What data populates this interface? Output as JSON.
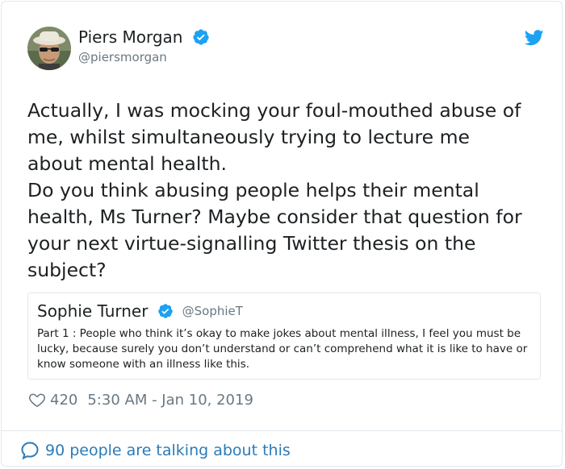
{
  "author": {
    "display_name": "Piers Morgan",
    "handle": "@piersmorgan",
    "verified": true,
    "avatar_icon": "avatar-photo"
  },
  "tweet": {
    "text": "Actually, I was mocking your foul-mouthed abuse of\nme, whilst simultaneously trying to lecture me\nabout mental health.\nDo you think abusing people helps their mental\nhealth, Ms Turner? Maybe consider that question for\nyour next virtue-signalling Twitter thesis on the\nsubject?"
  },
  "quoted_tweet": {
    "display_name": "Sophie Turner",
    "handle": "@SophieT",
    "verified": true,
    "text": "Part 1 : People who think it’s okay to make jokes about mental illness, I feel you must be lucky, because surely you don’t understand or can’t comprehend what it is like to have or know someone with an illness like this."
  },
  "meta": {
    "likes": "420",
    "timestamp": "5:30 AM - Jan 10, 2019"
  },
  "footer": {
    "talking_text": "90 people are talking about this"
  },
  "colors": {
    "link_blue": "#2b7bb9",
    "twitter_blue": "#1da1f2",
    "muted_gray": "#697882",
    "border": "#e1e8ed"
  },
  "icons": [
    "verified-badge-icon",
    "twitter-bird-icon",
    "heart-icon",
    "speech-bubble-icon"
  ]
}
